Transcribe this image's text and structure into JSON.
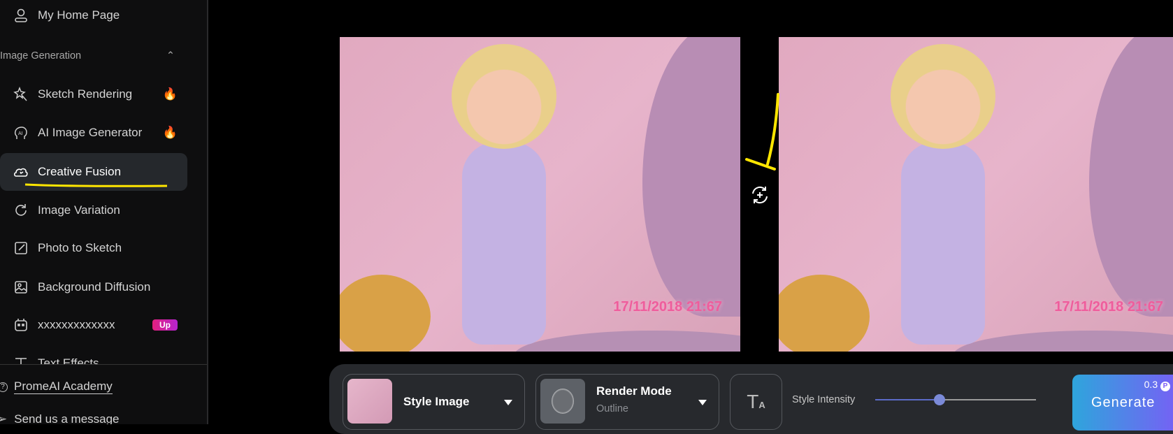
{
  "sidebar": {
    "home": "My Home Page",
    "section": "Image Generation",
    "items": [
      {
        "label": "Sketch Rendering",
        "badge": "fire"
      },
      {
        "label": "AI Image Generator",
        "badge": "fire"
      },
      {
        "label": "Creative Fusion",
        "active": true
      },
      {
        "label": "Image Variation"
      },
      {
        "label": "Photo to Sketch"
      },
      {
        "label": "Background Diffusion"
      },
      {
        "label": "xxxxxxxxxxxxx",
        "badge": "Up"
      },
      {
        "label": "Text Effects"
      }
    ],
    "academy": "PromeAI Academy",
    "message": "Send us a message"
  },
  "images": {
    "stamp": "17/11/2018 21:67"
  },
  "toolbar": {
    "style_image": "Style Image",
    "render_mode": "Render Mode",
    "render_value": "Outline",
    "intensity_label": "Style Intensity",
    "intensity_value": 0.4,
    "generate": "Generate",
    "cost": "0.3"
  },
  "colors": {
    "accent": "#7b8ad8",
    "highlight": "#ffe600",
    "badge": "#d6209a"
  }
}
